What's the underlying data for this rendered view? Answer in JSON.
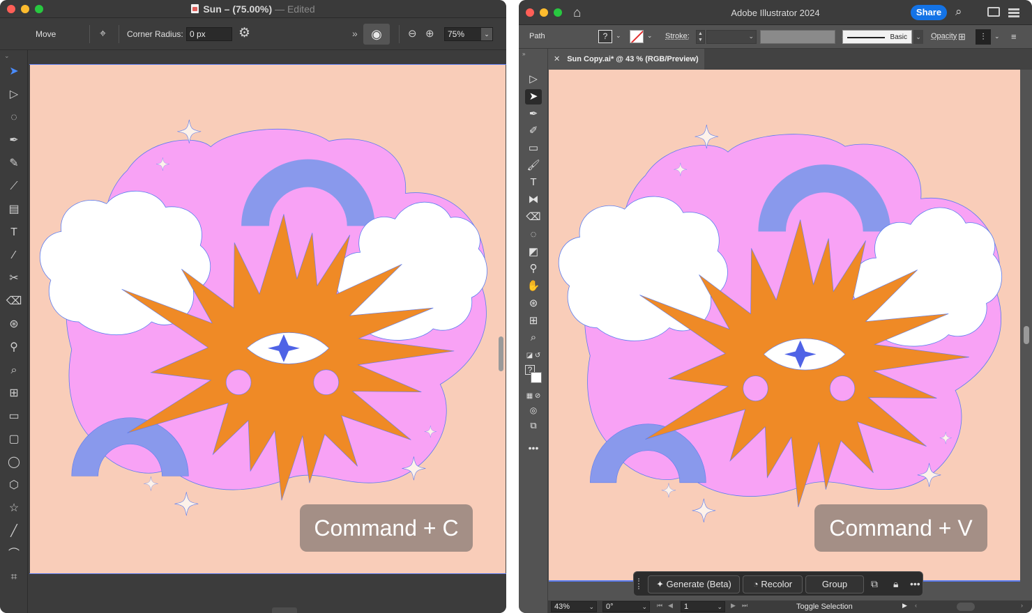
{
  "left": {
    "window_title": "Sun – (75.00%)",
    "window_status": "— Edited",
    "toolbar": {
      "move_label": "Move",
      "corner_radius_label": "Corner Radius:",
      "corner_radius_value": "0 px",
      "zoom_value": "75%"
    },
    "caption": "Command + C"
  },
  "right": {
    "app_title": "Adobe Illustrator 2024",
    "share_label": "Share",
    "control": {
      "path_label": "Path",
      "fill_unknown": "?",
      "stroke_label": "Stroke:",
      "brush_label": "Basic",
      "opacity_label": "Opacity"
    },
    "document_tab": "Sun Copy.ai* @ 43 % (RGB/Preview)",
    "caption": "Command + V",
    "contextual_bar": {
      "generate_label": "Generate (Beta)",
      "recolor_label": "Recolor",
      "group_label": "Group"
    },
    "status": {
      "zoom": "43%",
      "rotation": "0°",
      "artboard": "1",
      "selection_tool": "Toggle Selection"
    }
  },
  "colors": {
    "artboard_bg": "#f9cdb9",
    "pink_cloud": "#f8a2f5",
    "sun_orange": "#ef8a26",
    "arc_blue": "#8999ec",
    "eye_blue": "#4f63e6",
    "sparkle": "#fdf2ea",
    "share_blue": "#1473e6",
    "caption_bg": "#a48f86",
    "selection_outline": "#5a7cf0"
  }
}
